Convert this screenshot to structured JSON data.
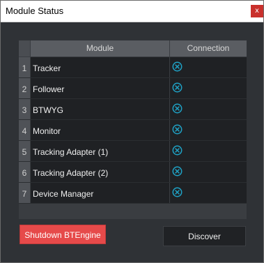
{
  "window": {
    "title": "Module Status",
    "close_glyph": "x"
  },
  "table": {
    "columns": [
      "Module",
      "Connection"
    ],
    "rows": [
      {
        "num": "1",
        "name": "Tracker",
        "connection_icon": "disconnected-icon"
      },
      {
        "num": "2",
        "name": "Follower",
        "connection_icon": "disconnected-icon"
      },
      {
        "num": "3",
        "name": "BTWYG",
        "connection_icon": "disconnected-icon"
      },
      {
        "num": "4",
        "name": "Monitor",
        "connection_icon": "disconnected-icon"
      },
      {
        "num": "5",
        "name": "Tracking Adapter (1)",
        "connection_icon": "disconnected-icon"
      },
      {
        "num": "6",
        "name": "Tracking Adapter (2)",
        "connection_icon": "disconnected-icon"
      },
      {
        "num": "7",
        "name": "Device Manager",
        "connection_icon": "disconnected-icon"
      }
    ]
  },
  "buttons": {
    "shutdown": "Shutdown BTEngine",
    "discover": "Discover"
  },
  "colors": {
    "status_icon": "#1fa3c7",
    "shutdown_bg": "#e64a4a",
    "window_bg": "#2f3236"
  }
}
